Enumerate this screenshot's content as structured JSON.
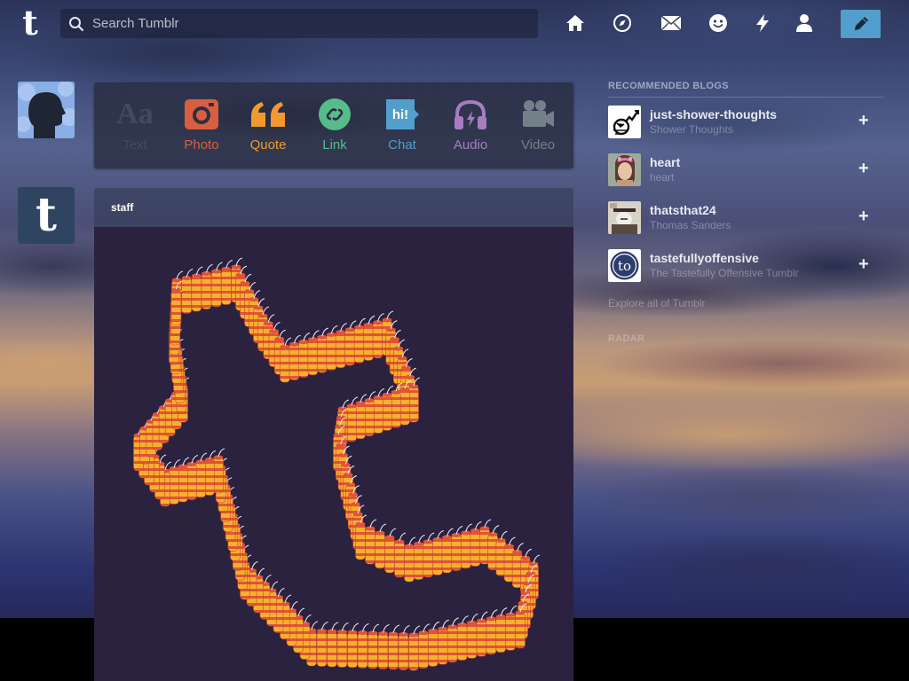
{
  "header": {
    "logo": "t",
    "search_placeholder": "Search Tumblr"
  },
  "nav": {
    "icons": [
      "home-icon",
      "explore-icon",
      "inbox-icon",
      "messaging-icon",
      "activity-icon",
      "account-icon",
      "compose-icon"
    ]
  },
  "dashboard": {
    "staff_avatar_letter": "t"
  },
  "post_types": [
    {
      "name": "Text",
      "label": "Text",
      "color": "#444a5e"
    },
    {
      "name": "Photo",
      "label": "Photo",
      "color": "#d95e40"
    },
    {
      "name": "Quote",
      "label": "Quote",
      "color": "#f2992e"
    },
    {
      "name": "Link",
      "label": "Link",
      "color": "#56bc8a"
    },
    {
      "name": "Chat",
      "label": "Chat",
      "color": "#529ecc"
    },
    {
      "name": "Audio",
      "label": "Audio",
      "color": "#a77dc2"
    },
    {
      "name": "Video",
      "label": "Video",
      "color": "#748089"
    }
  ],
  "post": {
    "author": "staff",
    "background_color": "#2b2240"
  },
  "sidebar": {
    "title": "RECOMMENDED BLOGS",
    "blogs": [
      {
        "name": "just-shower-thoughts",
        "subtitle": "Shower Thoughts"
      },
      {
        "name": "heart",
        "subtitle": "heart"
      },
      {
        "name": "thatsthat24",
        "subtitle": "Thomas Sanders"
      },
      {
        "name": "tastefullyoffensive",
        "subtitle": "The Tastefully Offensive Tumblr"
      }
    ],
    "explore_link": "Explore all of Tumblr",
    "radar_title": "RADAR"
  },
  "colors": {
    "accent": "#529ecc",
    "firecracker_red": "#e0533a",
    "firecracker_yellow": "#f5b12b"
  }
}
